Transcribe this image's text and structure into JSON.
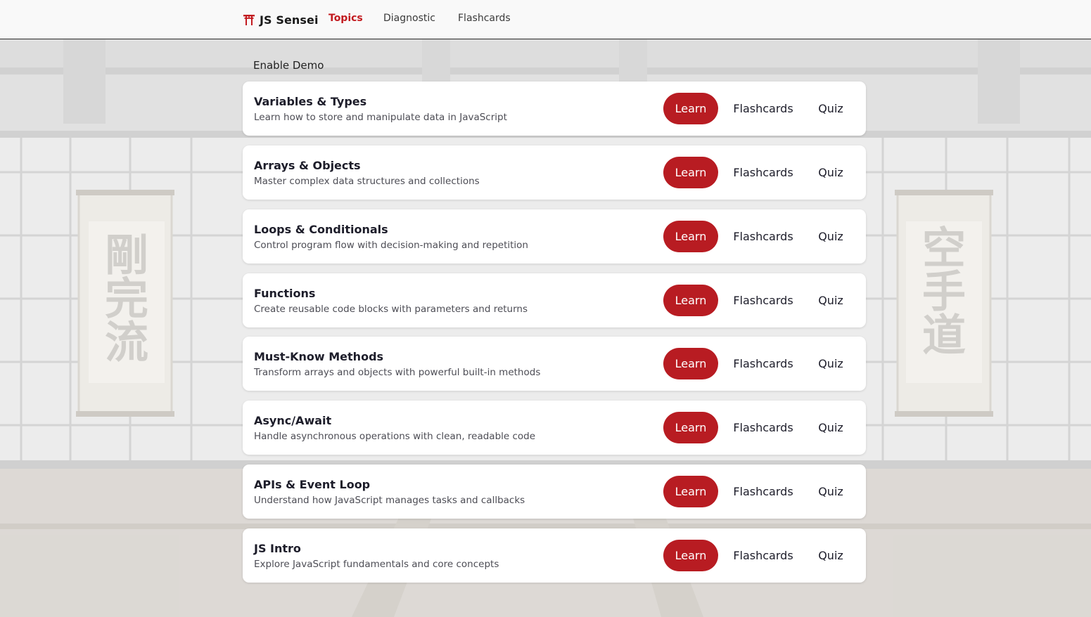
{
  "brand": {
    "name": "JS Sensei",
    "icon": "torii-gate-icon"
  },
  "nav": {
    "topics": "Topics",
    "diagnostic": "Diagnostic",
    "flashcards": "Flashcards",
    "active": "Topics"
  },
  "demo_label": "Enable Demo",
  "topics": [
    {
      "title": "Variables & Types",
      "description": "Learn how to store and manipulate data in JavaScript",
      "learn": "Learn",
      "flashcards": "Flashcards",
      "quiz": "Quiz"
    },
    {
      "title": "Arrays & Objects",
      "description": "Master complex data structures and collections",
      "learn": "Learn",
      "flashcards": "Flashcards",
      "quiz": "Quiz"
    },
    {
      "title": "Loops & Conditionals",
      "description": "Control program flow with decision-making and repetition",
      "learn": "Learn",
      "flashcards": "Flashcards",
      "quiz": "Quiz"
    },
    {
      "title": "Functions",
      "description": "Create reusable code blocks with parameters and returns",
      "learn": "Learn",
      "flashcards": "Flashcards",
      "quiz": "Quiz"
    },
    {
      "title": "Must-Know Methods",
      "description": "Transform arrays and objects with powerful built-in methods",
      "learn": "Learn",
      "flashcards": "Flashcards",
      "quiz": "Quiz"
    },
    {
      "title": "Async/Await",
      "description": "Handle asynchronous operations with clean, readable code",
      "learn": "Learn",
      "flashcards": "Flashcards",
      "quiz": "Quiz"
    },
    {
      "title": "APIs & Event Loop",
      "description": "Understand how JavaScript manages tasks and callbacks",
      "learn": "Learn",
      "flashcards": "Flashcards",
      "quiz": "Quiz"
    },
    {
      "title": "JS Intro",
      "description": "Explore JavaScript fundamentals and core concepts",
      "learn": "Learn",
      "flashcards": "Flashcards",
      "quiz": "Quiz"
    }
  ],
  "background": {
    "left_scroll_text": "剛完流",
    "right_scroll_text": "空手道"
  },
  "colors": {
    "accent": "#c21a1f",
    "learn_button": "#b81c22",
    "card": "#ffffff"
  }
}
